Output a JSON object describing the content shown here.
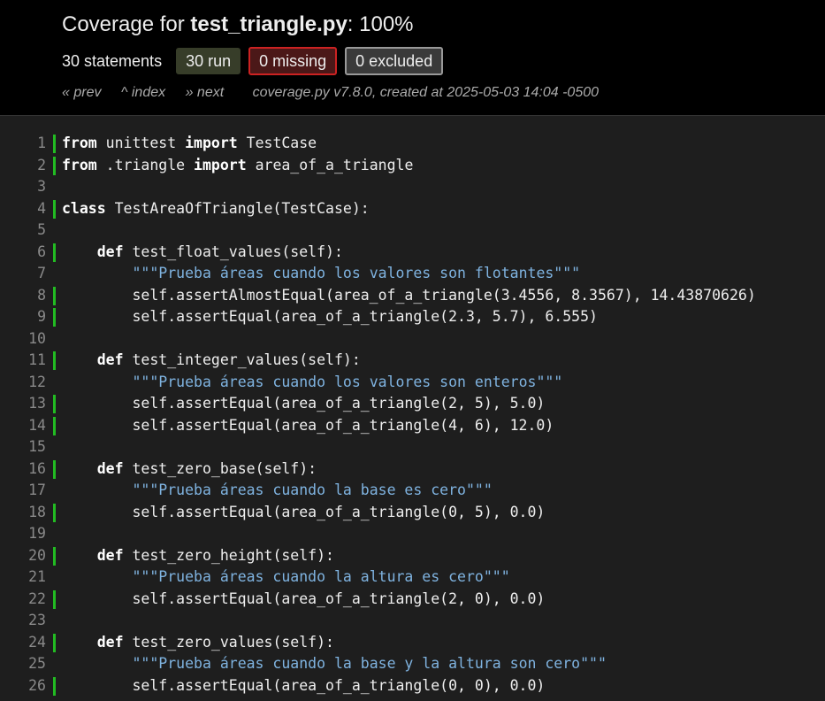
{
  "header": {
    "title_prefix": "Coverage for ",
    "file_name": "test_triangle.py",
    "title_suffix": ": 100%",
    "statements_label": "30 statements",
    "run_label": "30 run",
    "missing_label": "0 missing",
    "excluded_label": "0 excluded",
    "nav_prev": "« prev",
    "nav_index": "^ index",
    "nav_next": "» next",
    "meta": "coverage.py v7.8.0, created at 2025-05-03 14:04 -0500"
  },
  "colors": {
    "run_bar": "#22bb22",
    "missing_border": "#cc2222",
    "keyword": "#ffffff",
    "string": "#7fb3e0"
  },
  "lines": [
    {
      "n": "1",
      "run": true,
      "tokens": [
        [
          "kw",
          "from"
        ],
        [
          "t",
          " unittest "
        ],
        [
          "kw",
          "import"
        ],
        [
          "t",
          " TestCase"
        ]
      ]
    },
    {
      "n": "2",
      "run": true,
      "tokens": [
        [
          "kw",
          "from"
        ],
        [
          "t",
          " .triangle "
        ],
        [
          "kw",
          "import"
        ],
        [
          "t",
          " area_of_a_triangle"
        ]
      ]
    },
    {
      "n": "3",
      "run": false,
      "tokens": []
    },
    {
      "n": "4",
      "run": true,
      "tokens": [
        [
          "kw",
          "class"
        ],
        [
          "t",
          " TestAreaOfTriangle(TestCase):"
        ]
      ]
    },
    {
      "n": "5",
      "run": false,
      "tokens": []
    },
    {
      "n": "6",
      "run": true,
      "tokens": [
        [
          "t",
          "    "
        ],
        [
          "kw",
          "def"
        ],
        [
          "t",
          " test_float_values(self):"
        ]
      ]
    },
    {
      "n": "7",
      "run": false,
      "tokens": [
        [
          "t",
          "        "
        ],
        [
          "str",
          "\"\"\"Prueba áreas cuando los valores son flotantes\"\"\""
        ]
      ]
    },
    {
      "n": "8",
      "run": true,
      "tokens": [
        [
          "t",
          "        self.assertAlmostEqual(area_of_a_triangle(3.4556, 8.3567), 14.43870626)"
        ]
      ]
    },
    {
      "n": "9",
      "run": true,
      "tokens": [
        [
          "t",
          "        self.assertEqual(area_of_a_triangle(2.3, 5.7), 6.555)"
        ]
      ]
    },
    {
      "n": "10",
      "run": false,
      "tokens": []
    },
    {
      "n": "11",
      "run": true,
      "tokens": [
        [
          "t",
          "    "
        ],
        [
          "kw",
          "def"
        ],
        [
          "t",
          " test_integer_values(self):"
        ]
      ]
    },
    {
      "n": "12",
      "run": false,
      "tokens": [
        [
          "t",
          "        "
        ],
        [
          "str",
          "\"\"\"Prueba áreas cuando los valores son enteros\"\"\""
        ]
      ]
    },
    {
      "n": "13",
      "run": true,
      "tokens": [
        [
          "t",
          "        self.assertEqual(area_of_a_triangle(2, 5), 5.0)"
        ]
      ]
    },
    {
      "n": "14",
      "run": true,
      "tokens": [
        [
          "t",
          "        self.assertEqual(area_of_a_triangle(4, 6), 12.0)"
        ]
      ]
    },
    {
      "n": "15",
      "run": false,
      "tokens": []
    },
    {
      "n": "16",
      "run": true,
      "tokens": [
        [
          "t",
          "    "
        ],
        [
          "kw",
          "def"
        ],
        [
          "t",
          " test_zero_base(self):"
        ]
      ]
    },
    {
      "n": "17",
      "run": false,
      "tokens": [
        [
          "t",
          "        "
        ],
        [
          "str",
          "\"\"\"Prueba áreas cuando la base es cero\"\"\""
        ]
      ]
    },
    {
      "n": "18",
      "run": true,
      "tokens": [
        [
          "t",
          "        self.assertEqual(area_of_a_triangle(0, 5), 0.0)"
        ]
      ]
    },
    {
      "n": "19",
      "run": false,
      "tokens": []
    },
    {
      "n": "20",
      "run": true,
      "tokens": [
        [
          "t",
          "    "
        ],
        [
          "kw",
          "def"
        ],
        [
          "t",
          " test_zero_height(self):"
        ]
      ]
    },
    {
      "n": "21",
      "run": false,
      "tokens": [
        [
          "t",
          "        "
        ],
        [
          "str",
          "\"\"\"Prueba áreas cuando la altura es cero\"\"\""
        ]
      ]
    },
    {
      "n": "22",
      "run": true,
      "tokens": [
        [
          "t",
          "        self.assertEqual(area_of_a_triangle(2, 0), 0.0)"
        ]
      ]
    },
    {
      "n": "23",
      "run": false,
      "tokens": []
    },
    {
      "n": "24",
      "run": true,
      "tokens": [
        [
          "t",
          "    "
        ],
        [
          "kw",
          "def"
        ],
        [
          "t",
          " test_zero_values(self):"
        ]
      ]
    },
    {
      "n": "25",
      "run": false,
      "tokens": [
        [
          "t",
          "        "
        ],
        [
          "str",
          "\"\"\"Prueba áreas cuando la base y la altura son cero\"\"\""
        ]
      ]
    },
    {
      "n": "26",
      "run": true,
      "tokens": [
        [
          "t",
          "        self.assertEqual(area_of_a_triangle(0, 0), 0.0)"
        ]
      ]
    }
  ]
}
